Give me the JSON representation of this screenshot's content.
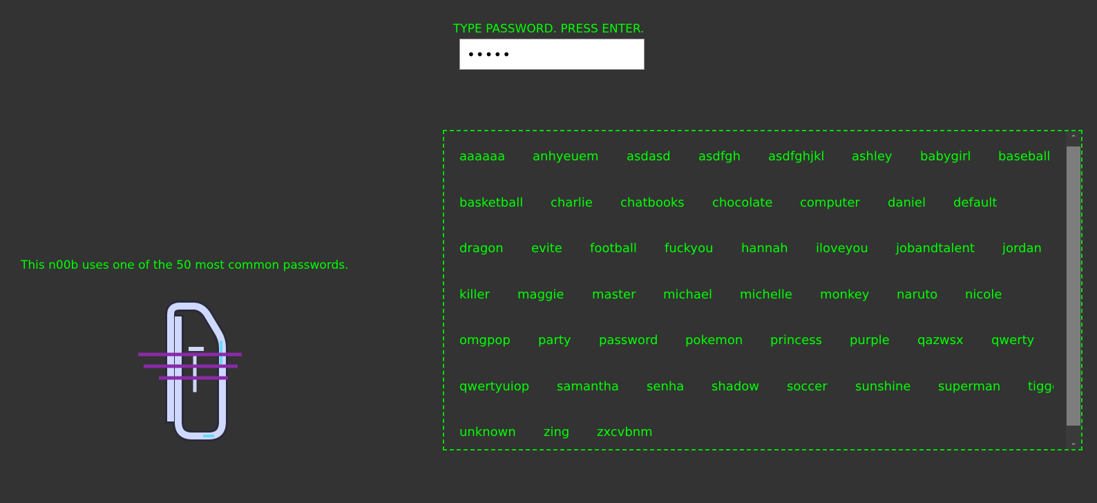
{
  "prompt": {
    "text": "TYPE PASSWORD. PRESS ENTER."
  },
  "password_input": {
    "value": "•••••"
  },
  "verdict": {
    "text": "This n00b uses one of the 50 most common passwords."
  },
  "mascot": {
    "icon": "paperclip-icon",
    "colors": {
      "outline": "#cfd8ff",
      "accent": "#66d9ff",
      "lines": "#8a2aa8"
    }
  },
  "colors": {
    "accent": "#00ff00",
    "background": "#333333"
  },
  "password_list": {
    "rows": [
      [
        "aaaaaa",
        "anhyeuem",
        "asdasd",
        "asdfgh",
        "asdfghjkl",
        "ashley",
        "babygirl",
        "baseball"
      ],
      [
        "basketball",
        "charlie",
        "chatbooks",
        "chocolate",
        "computer",
        "daniel",
        "default"
      ],
      [
        "dragon",
        "evite",
        "football",
        "fuckyou",
        "hannah",
        "iloveyou",
        "jobandtalent",
        "jordan"
      ],
      [
        "killer",
        "maggie",
        "master",
        "michael",
        "michelle",
        "monkey",
        "naruto",
        "nicole"
      ],
      [
        "omgpop",
        "party",
        "password",
        "pokemon",
        "princess",
        "purple",
        "qazwsx",
        "qwerty"
      ],
      [
        "qwertyuiop",
        "samantha",
        "senha",
        "shadow",
        "soccer",
        "sunshine",
        "superman",
        "tigger"
      ],
      [
        "unknown",
        "zing",
        "zxcvbnm"
      ]
    ]
  }
}
